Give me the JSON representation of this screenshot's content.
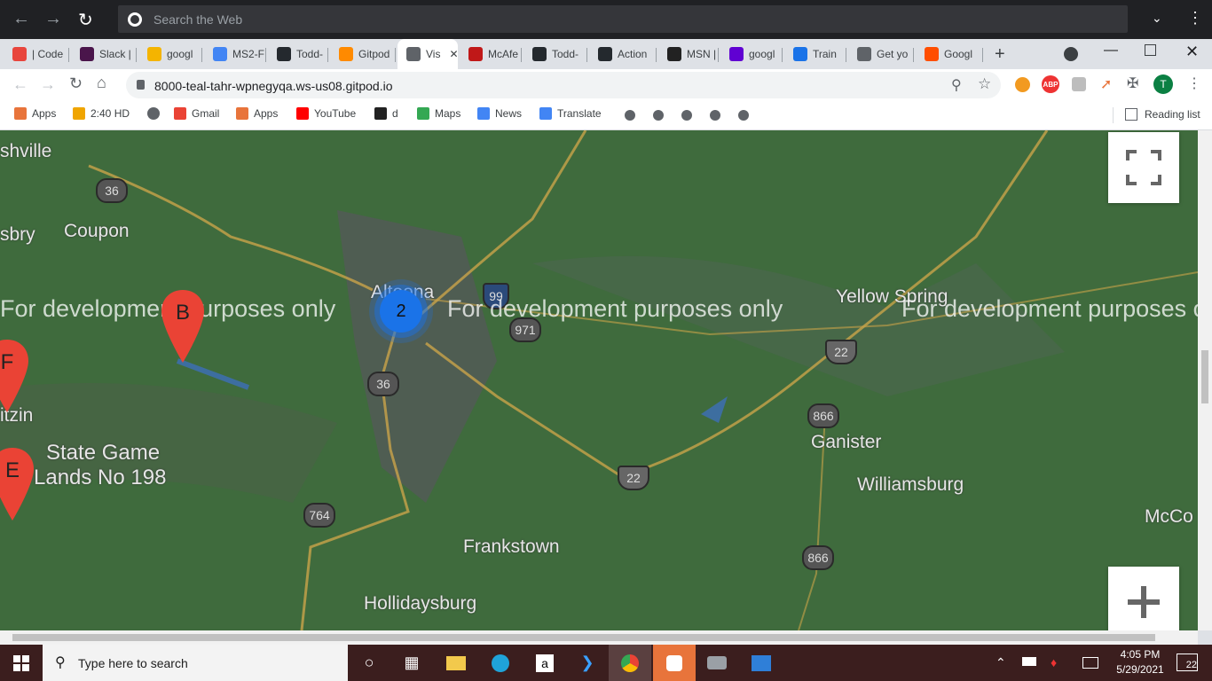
{
  "outer_bar": {
    "search_placeholder": "Search the Web"
  },
  "tabs": [
    {
      "label": "| Code",
      "icon": "circle-icon",
      "color": "#e8453c"
    },
    {
      "label": "Slack |",
      "icon": "slack-icon",
      "color": "#4a154b"
    },
    {
      "label": "googl",
      "icon": "google-icon",
      "color": "#f4b400"
    },
    {
      "label": "MS2-F",
      "icon": "docs-icon",
      "color": "#4285f4"
    },
    {
      "label": "Todd-",
      "icon": "github-icon",
      "color": "#24292e"
    },
    {
      "label": "Gitpod",
      "icon": "gitpod-icon",
      "color": "#ff8a00"
    },
    {
      "label": "Vis",
      "icon": "globe-icon",
      "color": "#5f6368",
      "active": true
    },
    {
      "label": "McAfe",
      "icon": "mcafee-icon",
      "color": "#c01818"
    },
    {
      "label": "Todd-",
      "icon": "github-icon",
      "color": "#24292e"
    },
    {
      "label": "Action",
      "icon": "github-icon",
      "color": "#24292e"
    },
    {
      "label": "MSN |",
      "icon": "msn-icon",
      "color": "#222222"
    },
    {
      "label": "googl",
      "icon": "yahoo-icon",
      "color": "#6001d2"
    },
    {
      "label": "Train",
      "icon": "flag-icon",
      "color": "#1a73e8"
    },
    {
      "label": "Get yo",
      "icon": "globe-icon",
      "color": "#5f6368"
    },
    {
      "label": "Googl",
      "icon": "ars-icon",
      "color": "#ff4e00"
    }
  ],
  "address": {
    "url": "8000-teal-tahr-wpnegyqa.ws-us08.gitpod.io"
  },
  "profile_initial": "T",
  "bookmarks": [
    {
      "label": "Apps",
      "icon": "apps-grid-icon"
    },
    {
      "label": "2:40 HD",
      "icon": "ph-icon"
    },
    {
      "label": "",
      "icon": "globe-icon"
    },
    {
      "label": "Gmail",
      "icon": "gmail-icon"
    },
    {
      "label": "Apps",
      "icon": "apps-grid-icon"
    },
    {
      "label": "YouTube",
      "icon": "youtube-icon"
    },
    {
      "label": "d",
      "icon": "amazon-icon"
    },
    {
      "label": "Maps",
      "icon": "maps-icon"
    },
    {
      "label": "News",
      "icon": "news-icon"
    },
    {
      "label": "Translate",
      "icon": "translate-icon"
    }
  ],
  "reading_list": "Reading list",
  "map": {
    "labels": [
      "shville",
      "sbry",
      "Coupon",
      "Altoona",
      "Yellow Spring",
      "Ganister",
      "Williamsburg",
      "McCo",
      "State Game",
      "Lands No 198",
      "itzin",
      "Frankstown",
      "Hollidaysburg"
    ],
    "shields": [
      "36",
      "36",
      "971",
      "22",
      "866",
      "22",
      "764",
      "866"
    ],
    "interstate": "99",
    "watermark": "For development purposes only",
    "markers": [
      "B",
      "F",
      "E"
    ],
    "cluster_count": "2"
  },
  "taskbar": {
    "search_placeholder": "Type here to search",
    "time": "4:05 PM",
    "date": "5/29/2021",
    "notifications": "22"
  }
}
